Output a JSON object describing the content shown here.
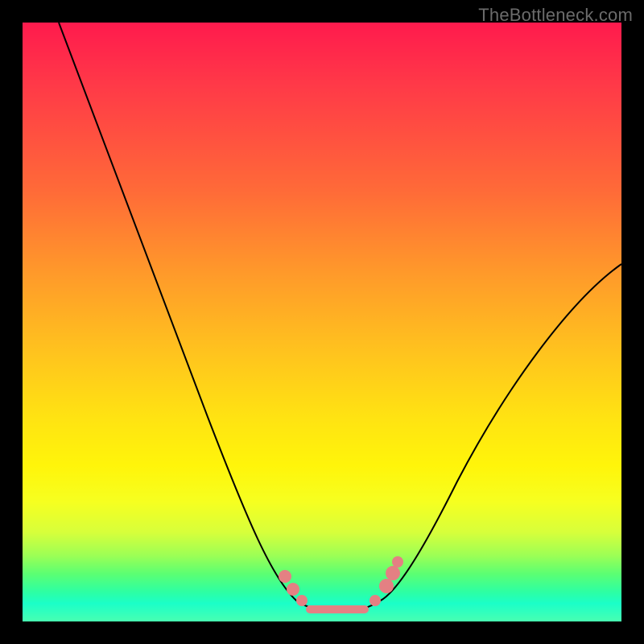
{
  "watermark": "TheBottleneck.com",
  "colors": {
    "page_bg": "#000000",
    "gradient_top": "#ff1a4d",
    "gradient_bottom": "#48ffb2",
    "curve": "#000000",
    "markers": "#e48083"
  },
  "chart_data": {
    "type": "line",
    "title": "",
    "xlabel": "",
    "ylabel": "",
    "xlim": [
      0,
      100
    ],
    "ylim": [
      0,
      100
    ],
    "note": "Axes are unlabeled; values are read off pixel positions as percentages of the plot area. y = bottleneck percentage (0 at bottom / green, 100 at top / red). Curve is a V shape with a flat trough around x≈47–59.",
    "series": [
      {
        "name": "bottleneck-curve",
        "x": [
          6,
          10,
          15,
          20,
          25,
          30,
          35,
          40,
          44,
          47,
          50,
          53,
          56,
          59,
          62,
          66,
          72,
          80,
          90,
          100
        ],
        "y": [
          100,
          90,
          78,
          66,
          54,
          42,
          31,
          19,
          10,
          4,
          3,
          3,
          3,
          4,
          8,
          14,
          22,
          33,
          46,
          59
        ]
      }
    ],
    "markers": {
      "name": "trough-markers",
      "points": [
        {
          "x": 44,
          "y": 10
        },
        {
          "x": 46,
          "y": 6
        },
        {
          "x": 48,
          "y": 4
        },
        {
          "x": 50,
          "y": 3.5
        },
        {
          "x": 52,
          "y": 3.2
        },
        {
          "x": 54,
          "y": 3.2
        },
        {
          "x": 56,
          "y": 3.5
        },
        {
          "x": 58,
          "y": 4.2
        },
        {
          "x": 61,
          "y": 8
        },
        {
          "x": 62.5,
          "y": 11
        }
      ]
    }
  }
}
